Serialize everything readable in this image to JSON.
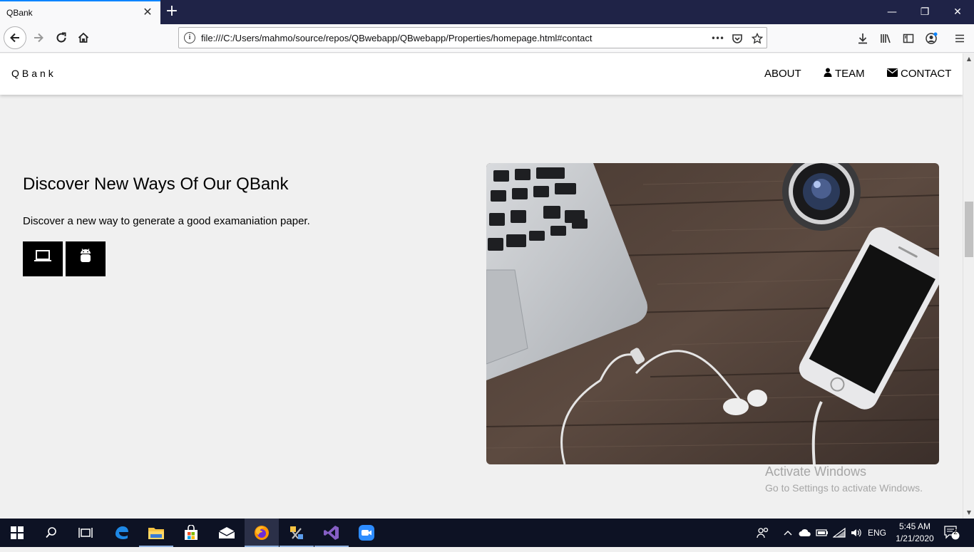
{
  "browser": {
    "tab_title": "QBank",
    "tab_close": "✕",
    "new_tab": "+",
    "url": "file:///C:/Users/mahmo/source/repos/QBwebapp/QBwebapp/Properties/homepage.html#contact",
    "url_info": "i",
    "url_menu": "•••",
    "window_minimize": "—",
    "window_restore": "❐",
    "window_close": "✕"
  },
  "site": {
    "brand": "QBank",
    "nav": [
      {
        "label": "ABOUT",
        "icon": ""
      },
      {
        "label": "TEAM",
        "icon": "user-icon"
      },
      {
        "label": "CONTACT",
        "icon": "envelope-icon"
      }
    ],
    "headline": "Discover New Ways Of Our QBank",
    "subtext": "Discover a new way to generate a good examaniation paper.",
    "buttons": [
      {
        "icon": "laptop-icon"
      },
      {
        "icon": "android-icon"
      }
    ],
    "image": {
      "subject": "laptop, camera lens, smartphone and earphones on wooden desk"
    }
  },
  "watermark": {
    "line1": "Activate Windows",
    "line2": "Go to Settings to activate Windows."
  },
  "taskbar": {
    "language": "ENG",
    "time": "5:45 AM",
    "date": "1/21/2020",
    "notifications": "2"
  }
}
